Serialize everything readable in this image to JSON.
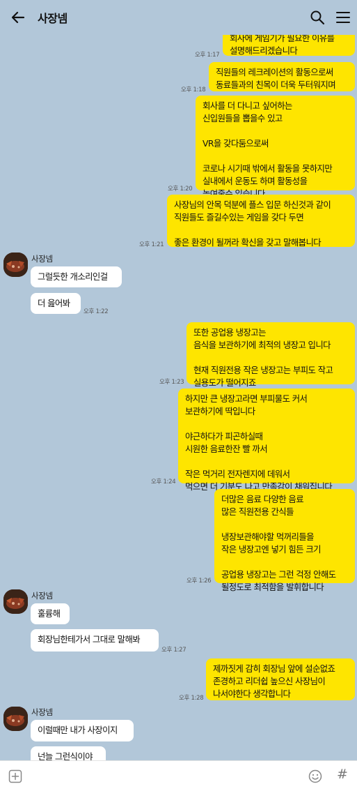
{
  "header": {
    "title": "사장넴",
    "back_icon": "arrow-left-icon",
    "search_icon": "search-icon",
    "menu_icon": "hamburger-menu-icon"
  },
  "messages": [
    {
      "from": "me",
      "text": "회사에 게임기가 필요한 이유를\n설명해드리겠습니다",
      "time": "오후 1:17"
    },
    {
      "from": "me",
      "text": "직원들의 레크레이션의 활동으로써\n동료들과의 친목이 더욱 두터워지며",
      "time": "오후 1:18"
    },
    {
      "from": "me",
      "text": "회사를 더 다니고 싶어하는\n신입원들을 뽑을수 있고\n\nVR을 갖다둠으로써\n\n코로나 시기때  밖에서 활동을 못하지만\n실내에서 운동도 하며 활동성을\n높여줄수 있습니다",
      "time": "오후 1:20"
    },
    {
      "from": "me",
      "text": "사장님의 안목 덕분에 플스 입문 하신것과 같이\n직원들도 즐길수있는 게임을 갖다 두면\n\n좋은 환경이 될꺼라 확신을 갖고 말해봅니다",
      "time": "오후 1:21"
    },
    {
      "from": "other",
      "sender": "사장넴",
      "text": "그럴듯한 개소리인걸"
    },
    {
      "from": "other",
      "text": "더 읊어봐",
      "time": "오후 1:22"
    },
    {
      "from": "me",
      "text": "또한 공업용 냉장고는\n음식을 보관하기에 최적의 냉장고 입니다\n\n현재 직원전용 작은 냉장고는 부피도 작고\n실용도가 떨어지죠",
      "time": "오후 1:23"
    },
    {
      "from": "me",
      "text": "하지만 큰 냉장고라면 부피물도 커서\n보관하기에 딱입니다\n\n야근하다가 피곤하실때\n시원한 음료한잔 빨 까서\n\n작은 먹거리 전자렌지에 데워서\n먹으면 더 기분도 나고 만족감이 채워집니다",
      "time": "오후 1:24"
    },
    {
      "from": "me",
      "text": "더많은 음료 다양한 음료\n많은 직원전용 간식들\n\n냉장보관해야할 먹꺼리들을\n작은 냉장고엔 넣기 힘든 크기\n\n공업용 냉장고는 그런 걱정 안해도\n될정도로 최적함을 발휘합니다",
      "time": "오후 1:26"
    },
    {
      "from": "other",
      "sender": "사장넴",
      "text": "훌륭해"
    },
    {
      "from": "other",
      "text": "회장님한테가서 그대로 말해봐",
      "time": "오후 1:27"
    },
    {
      "from": "me",
      "text": "제까짓게 감히 회장님 앞에 설순없죠\n존경하고 리더쉽 높으신 사장님이\n나서야한다 생각합니다",
      "time": "오후 1:28"
    },
    {
      "from": "other",
      "sender": "사장넴",
      "text": "이럴때만 내가 사장이지"
    },
    {
      "from": "other",
      "text": "넌늘 그런식이야"
    }
  ],
  "input_bar": {
    "plus_icon": "plus-square-icon",
    "emoji_icon": "smiley-icon",
    "hash_label": "#"
  },
  "colors": {
    "background": "#b2c7d9",
    "my_bubble": "#fee500",
    "other_bubble": "#ffffff"
  }
}
